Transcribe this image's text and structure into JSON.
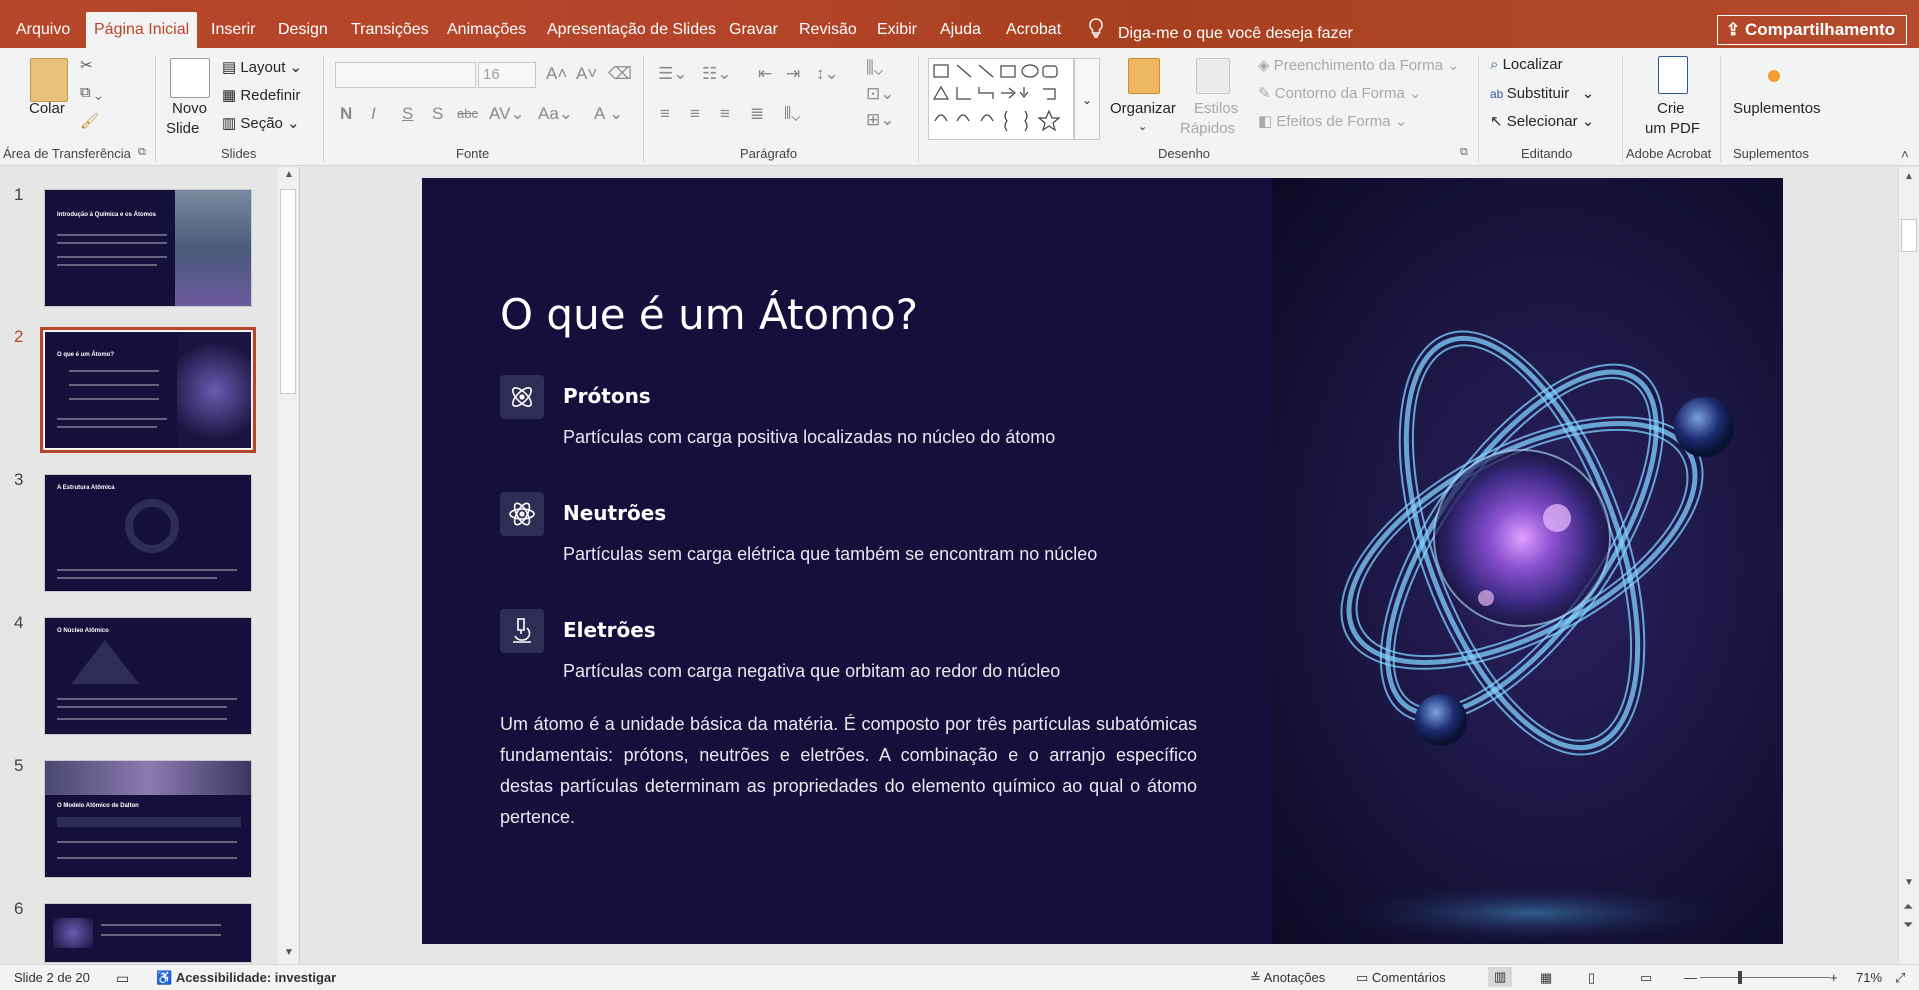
{
  "tabs": [
    "Arquivo",
    "Página Inicial",
    "Inserir",
    "Design",
    "Transições",
    "Animações",
    "Apresentação de Slides",
    "Gravar",
    "Revisão",
    "Exibir",
    "Ajuda",
    "Acrobat"
  ],
  "active_tab": "Página Inicial",
  "tell_me": "Diga-me o que você deseja fazer",
  "share_label": "Compartilhamento",
  "ribbon": {
    "clipboard": {
      "paste": "Colar",
      "group": "Área de Transferência"
    },
    "slides": {
      "new_slide_line1": "Novo",
      "new_slide_line2": "Slide",
      "layout": "Layout",
      "reset": "Redefinir",
      "section": "Seção",
      "group": "Slides"
    },
    "font": {
      "size": "16",
      "group": "Fonte"
    },
    "paragraph": {
      "group": "Parágrafo"
    },
    "drawing": {
      "arrange": "Organizar",
      "quick_styles_line1": "Estilos",
      "quick_styles_line2": "Rápidos",
      "shape_fill": "Preenchimento da Forma",
      "shape_outline": "Contorno da Forma",
      "shape_effects": "Efeitos de Forma",
      "group": "Desenho"
    },
    "editing": {
      "find": "Localizar",
      "replace": "Substituir",
      "select": "Selecionar",
      "group": "Editando"
    },
    "acrobat": {
      "create_line1": "Crie",
      "create_line2": "um PDF",
      "group": "Adobe Acrobat"
    },
    "addins": {
      "label": "Suplementos",
      "group": "Suplementos"
    }
  },
  "thumbnails": {
    "numbers": [
      "1",
      "2",
      "3",
      "4",
      "5",
      "6"
    ],
    "titles": [
      "Introdução à Química e os Átomos",
      "O que é um Átomo?",
      "A Estrutura Atômica",
      "O Núcleo Atômico",
      "O Modelo Atômico de Dalton",
      ""
    ],
    "active_index": 2
  },
  "slide": {
    "title": "O que é um Átomo?",
    "items": [
      {
        "heading": "Prótons",
        "description": "Partículas com carga positiva localizadas no núcleo do átomo",
        "icon": "atom-icon"
      },
      {
        "heading": "Neutrões",
        "description": "Partículas sem carga elétrica que também se encontram no núcleo",
        "icon": "atom-orbit-icon"
      },
      {
        "heading": "Eletrões",
        "description": "Partículas com carga negativa que orbitam ao redor do núcleo",
        "icon": "microscope-icon"
      }
    ],
    "body": "Um átomo é a unidade básica da matéria. É composto por três partículas subatómicas fundamentais: prótons, neutrões e eletrões. A combinação e o arranjo específico destas partículas determinam as propriedades do elemento químico ao qual o átomo pertence."
  },
  "status": {
    "slide_counter": "Slide 2 de 20",
    "accessibility": "Acessibilidade: investigar",
    "notes": "Anotações",
    "comments": "Comentários",
    "zoom": "71%"
  },
  "colors": {
    "accent": "#b7472a",
    "slide_bg": "#14103b",
    "icon_bg": "#2f2c55",
    "orbit": "#7fd3ff"
  }
}
